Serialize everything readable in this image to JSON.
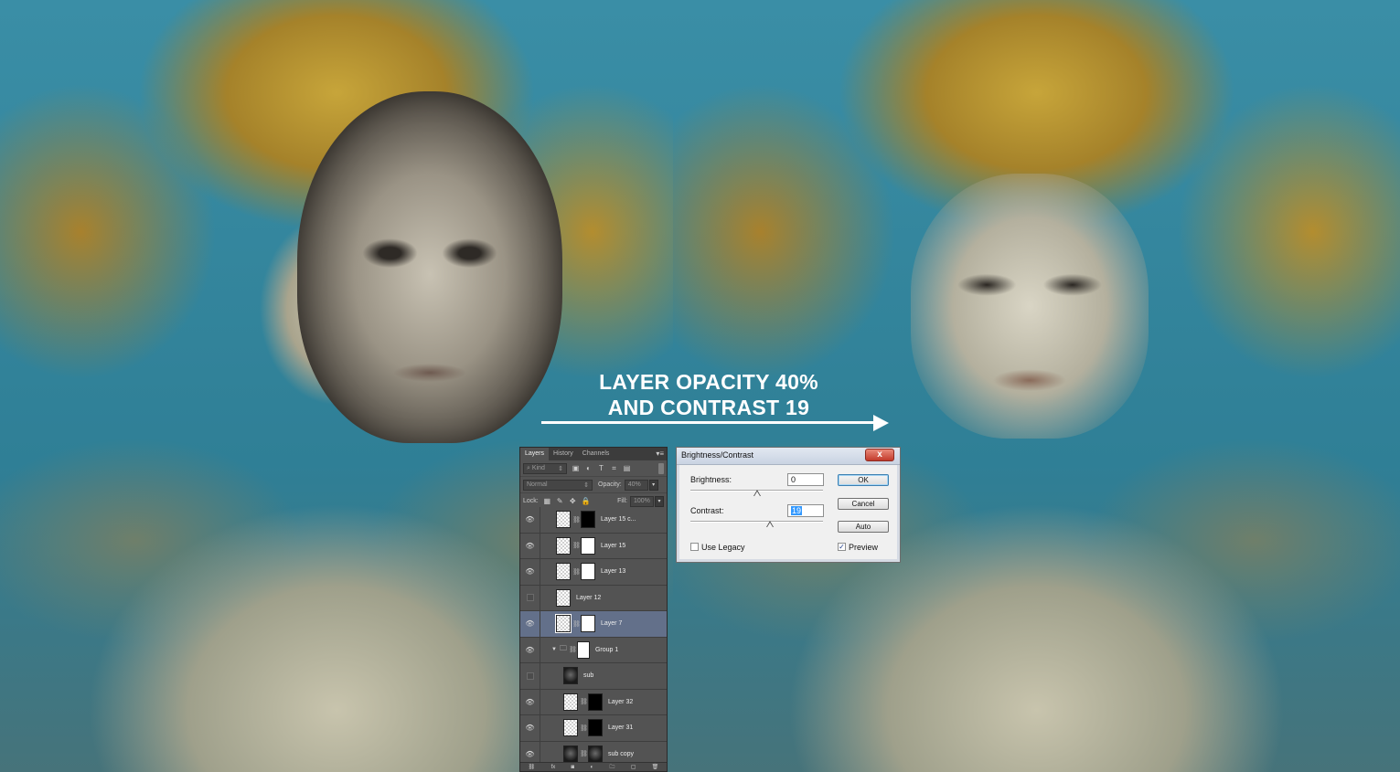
{
  "annotation": {
    "line1": "LAYER OPACITY 40%",
    "line2": "AND CONTRAST 19"
  },
  "layers_panel": {
    "tabs": [
      "Layers",
      "History",
      "Channels"
    ],
    "panel_menu_icon": "panel-menu-icon",
    "filter_kind": "Kind",
    "blend_mode": "Normal",
    "opacity_label": "Opacity:",
    "opacity_value": "40%",
    "lock_label": "Lock:",
    "fill_label": "Fill:",
    "fill_value": "100%",
    "layers": [
      {
        "name": "Layer 15 c...",
        "visible": true,
        "selected": false,
        "thumb": "checker",
        "mask": "black",
        "linked": true
      },
      {
        "name": "Layer 15",
        "visible": true,
        "selected": false,
        "thumb": "checker",
        "mask": "white",
        "linked": true
      },
      {
        "name": "Layer 13",
        "visible": true,
        "selected": false,
        "thumb": "checker",
        "mask": "white",
        "linked": true
      },
      {
        "name": "Layer 12",
        "visible": false,
        "selected": false,
        "thumb": "checker",
        "mask": null,
        "linked": false
      },
      {
        "name": "Layer 7",
        "visible": true,
        "selected": true,
        "thumb": "checker",
        "mask": "white",
        "linked": true
      },
      {
        "name": "Group 1",
        "visible": true,
        "selected": false,
        "thumb": "folder",
        "mask": "white",
        "linked": true
      },
      {
        "name": "sub",
        "visible": false,
        "selected": false,
        "thumb": "dark",
        "mask": null,
        "linked": false
      },
      {
        "name": "Layer 32",
        "visible": true,
        "selected": false,
        "thumb": "checker",
        "mask": "black",
        "linked": true
      },
      {
        "name": "Layer 31",
        "visible": true,
        "selected": false,
        "thumb": "checker",
        "mask": "black",
        "linked": true
      },
      {
        "name": "sub copy",
        "visible": true,
        "selected": false,
        "thumb": "dark",
        "mask": "dark",
        "linked": true
      }
    ]
  },
  "dialog": {
    "title": "Brightness/Contrast",
    "close_label": "x",
    "brightness_label": "Brightness:",
    "brightness_value": "0",
    "contrast_label": "Contrast:",
    "contrast_value": "19",
    "ok_label": "OK",
    "cancel_label": "Cancel",
    "auto_label": "Auto",
    "use_legacy_label": "Use Legacy",
    "use_legacy_checked": false,
    "preview_label": "Preview",
    "preview_checked": true
  },
  "colors": {
    "layer_selected": "#63708a",
    "panel_bg": "#535353",
    "dialog_close": "#c23a2b"
  }
}
